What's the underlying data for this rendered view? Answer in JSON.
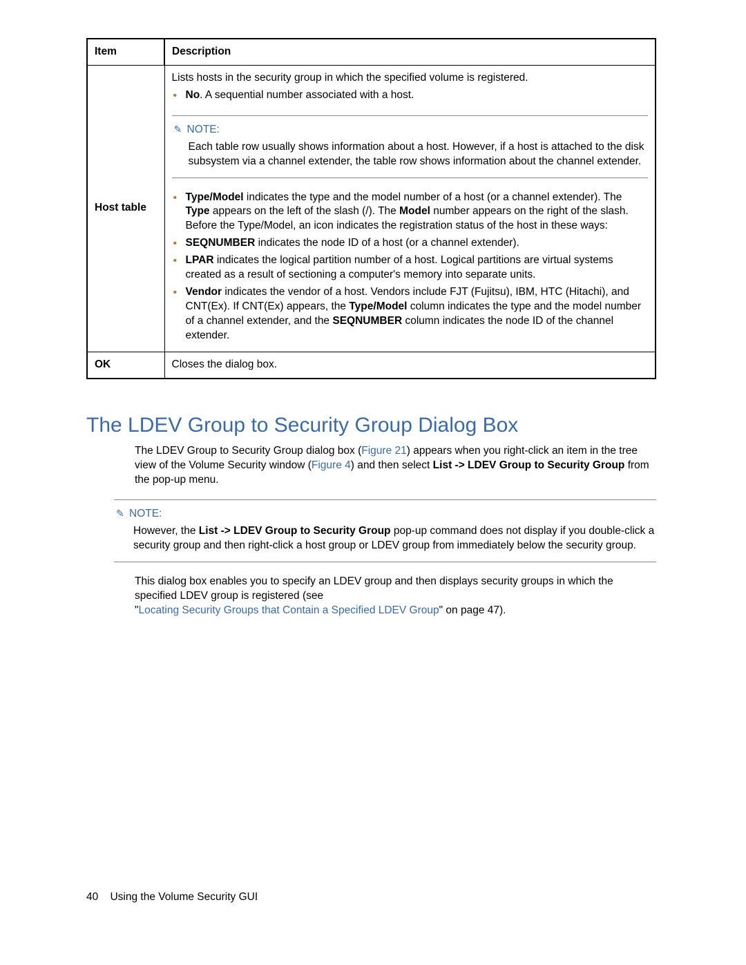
{
  "table": {
    "headers": {
      "item": "Item",
      "desc": "Description"
    },
    "host": {
      "item_html": "<span class=\"b\">Host</span> table",
      "intro": "Lists hosts in the security group in which the specified volume is registered.",
      "no_li": "<span class=\"b\">No</span>. A sequential number associated with a host.",
      "note_label": "NOTE:",
      "note_text": "Each table row usually shows information about a host. However, if a host is attached to the disk subsystem via a channel extender, the table row shows information about the channel extender.",
      "type_li": "<span class=\"b\">Type/Model</span> indicates the type and the model number of a host (or a channel extender). The <span class=\"b\">Type</span> appears on the left of the slash (/). The <span class=\"b\">Model</span> number appears on the right of the slash. Before the Type/Model, an icon indicates the registration status of the host in these ways:",
      "seq_li": "<span class=\"b\">SEQNUMBER</span> indicates the node ID of a host (or a channel extender).",
      "lpar_li": "<span class=\"b\">LPAR</span> indicates the logical partition number of a host. Logical partitions are virtual systems created as a result of sectioning a computer's memory into separate units.",
      "vendor_li": "<span class=\"b\">Vendor</span> indicates the vendor of a host. Vendors include FJT (Fujitsu), IBM, HTC (Hitachi), and CNT(Ex). If CNT(Ex) appears, the <span class=\"b\">Type/Model</span> column indicates the type and the model number of a channel extender, and the <span class=\"b\">SEQNUMBER</span> column indicates the node ID of the channel extender."
    },
    "ok": {
      "item": "OK",
      "desc": "Closes the dialog box."
    }
  },
  "section": {
    "title": "The LDEV Group to Security Group Dialog Box",
    "p1": "The LDEV Group to Security Group dialog box (<span class=\"linkblue\">Figure 21</span>) appears when you right-click an item in the tree view of the Volume Security window (<span class=\"linkblue\">Figure 4</span>) and then select <span class=\"b\">List -> LDEV Group to Security Group</span> from the pop-up menu.",
    "note_label": "NOTE:",
    "note_text": "However, the <span class=\"b\">List -> LDEV Group to Security Group</span> pop-up command does not display if you double-click a security group and then right-click a host group or LDEV group from immediately below the security group.",
    "p2": "This dialog box enables you to specify an LDEV group and then displays security groups in which the specified LDEV group is registered (see",
    "p2link": "\"<span class=\"linkblue\">Locating Security Groups that Contain a Specified LDEV Group</span>\" on page 47)."
  },
  "footer": {
    "page": "40",
    "title": "Using the Volume Security GUI"
  }
}
